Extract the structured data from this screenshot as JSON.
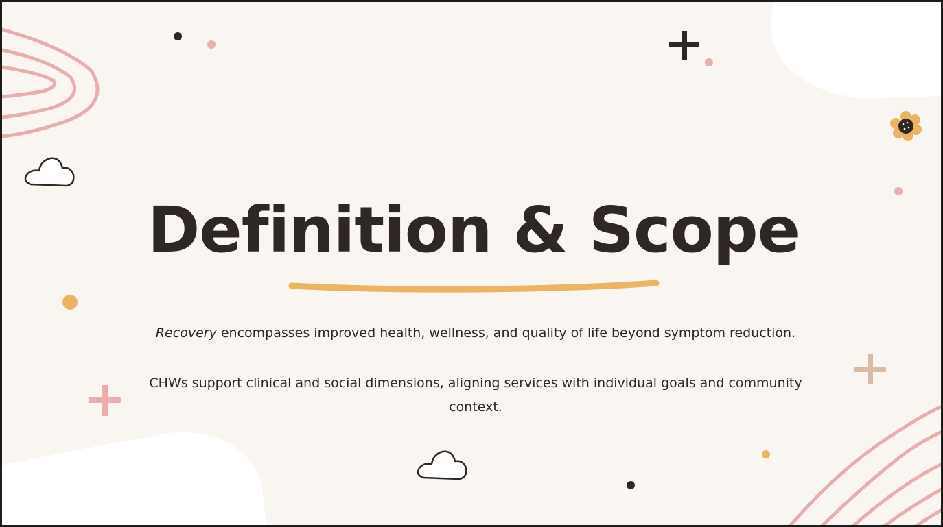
{
  "slide": {
    "title": "Definition & Scope",
    "paragraph1": {
      "emphasis": "Recovery",
      "rest": " encompasses improved health, wellness, and quality of life beyond symptom reduction."
    },
    "paragraph2": "CHWs support clinical and social dimensions, aligning services with individual goals and community context."
  },
  "colors": {
    "background": "#f9f5f0",
    "title": "#2e2724",
    "underline_accent": "#ebb463",
    "pink_accent": "#e8adad",
    "tan_accent": "#d9baa4",
    "dark_dot": "#2e2724",
    "border": "#1c1c1c"
  },
  "decorations": {
    "icons": [
      "cloud-icon",
      "flower-icon",
      "plus-icon",
      "dot",
      "curved-line",
      "white-blob"
    ]
  }
}
